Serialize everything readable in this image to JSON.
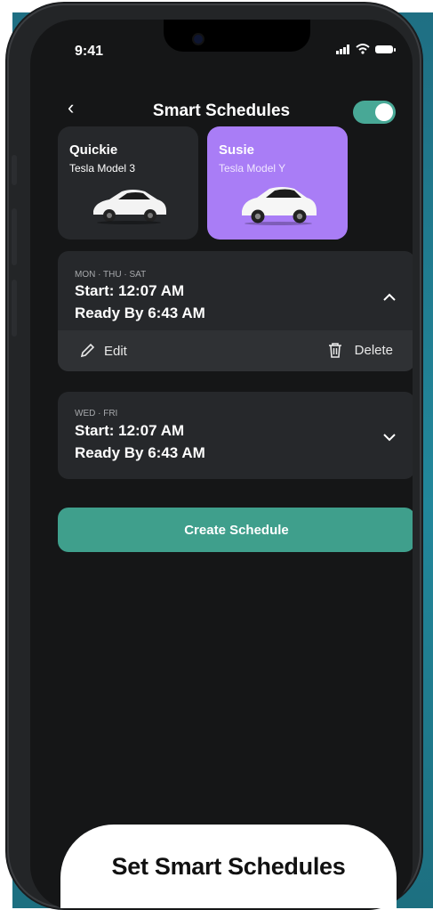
{
  "status": {
    "time": "9:41"
  },
  "header": {
    "title": "Smart Schedules",
    "toggle_on": true
  },
  "vehicles": [
    {
      "name": "Quickie",
      "model": "Tesla Model 3",
      "selected": false
    },
    {
      "name": "Susie",
      "model": "Tesla Model Y",
      "selected": true
    }
  ],
  "schedules": [
    {
      "days": "MON · THU · SAT",
      "start": "Start: 12:07 AM",
      "ready": "Ready By 6:43 AM",
      "expanded": true,
      "edit_label": "Edit",
      "delete_label": "Delete"
    },
    {
      "days": "WED · FRI",
      "start": "Start: 12:07 AM",
      "ready": "Ready By 6:43 AM",
      "expanded": false
    }
  ],
  "create_label": "Create Schedule",
  "caption": "Set Smart Schedules",
  "colors": {
    "accent_teal": "#3f9f8c",
    "selected_purple": "#a97df6",
    "screen_bg": "#151617",
    "card_bg": "#26282b"
  },
  "icons": [
    "back-chevron-icon",
    "signal-icon",
    "wifi-icon",
    "battery-icon",
    "car-image",
    "pencil-icon",
    "trash-icon",
    "chevron-up-icon",
    "chevron-down-icon"
  ]
}
